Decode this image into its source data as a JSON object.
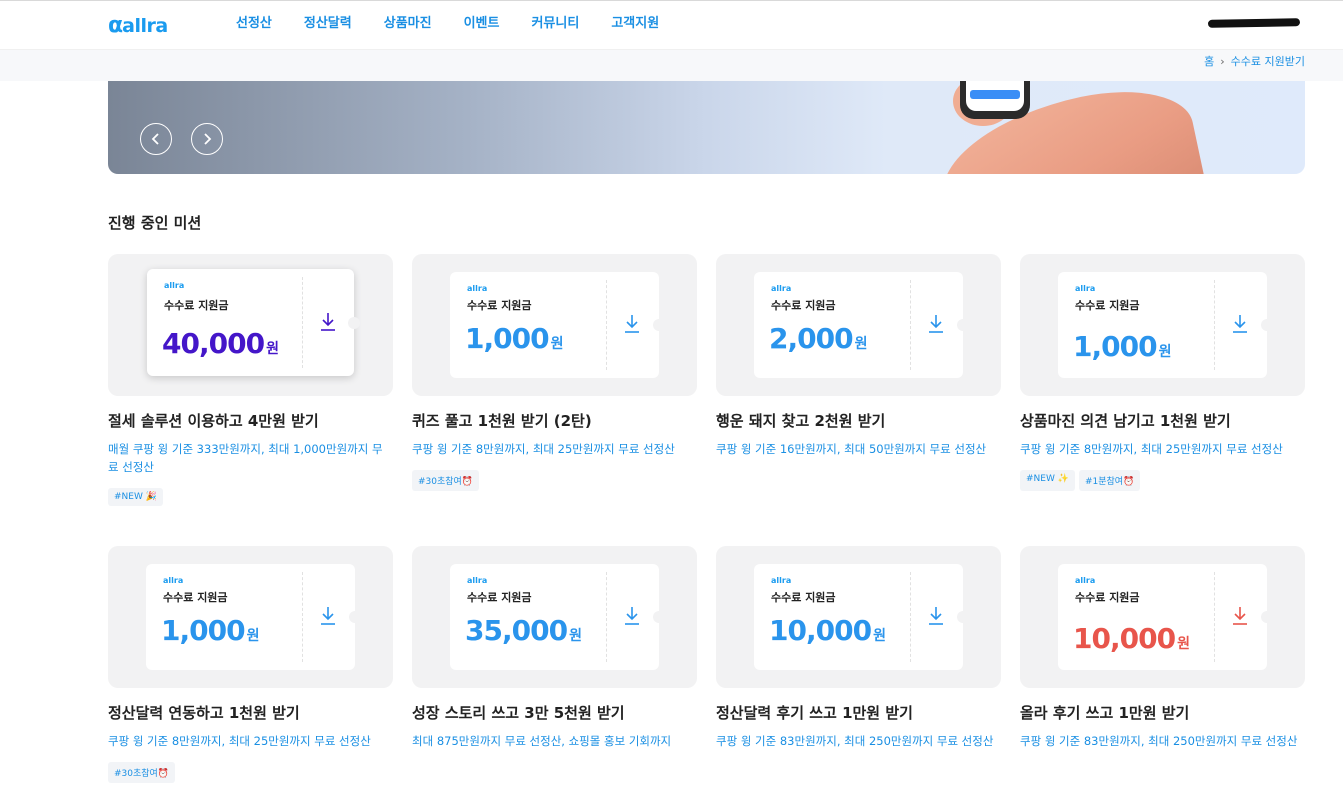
{
  "header": {
    "logo_mark": "α",
    "logo_word": "allra",
    "nav": [
      "선정산",
      "정산달력",
      "상품마진",
      "이벤트",
      "커뮤니티",
      "고객지원"
    ]
  },
  "breadcrumb": {
    "home": "홈",
    "current": "수수료 지원받기"
  },
  "banner": {
    "prev_icon": "chevron-left-icon",
    "next_icon": "chevron-right-icon"
  },
  "section": {
    "title": "진행 중인 미션"
  },
  "coupon": {
    "logo": "allra",
    "label": "수수료 지원금",
    "unit": "원"
  },
  "colors": {
    "brand": "#1a9bef",
    "purple": "#4416c9",
    "blue": "#2a94ec",
    "red": "#e8554b"
  },
  "missions": [
    {
      "amount": "40,000",
      "title": "절세 솔루션 이용하고 4만원 받기",
      "desc": "매월 쿠팡 윙 기준 333만원까지, 최대 1,000만원까지 무료 선정산",
      "tags": [
        "#NEW 🎉"
      ]
    },
    {
      "amount": "1,000",
      "title": "퀴즈 풀고 1천원 받기 (2탄)",
      "desc": "쿠팡 윙 기준 8만원까지, 최대 25만원까지 무료 선정산",
      "tags": [
        "#30초참여⏰"
      ]
    },
    {
      "amount": "2,000",
      "title": "행운 돼지 찾고 2천원 받기",
      "desc": "쿠팡 윙 기준 16만원까지, 최대 50만원까지 무료 선정산",
      "tags": []
    },
    {
      "amount": "1,000",
      "title": "상품마진 의견 남기고 1천원 받기",
      "desc": "쿠팡 윙 기준 8만원까지, 최대 25만원까지 무료 선정산",
      "tags": [
        "#NEW ✨",
        "#1분참여⏰"
      ]
    },
    {
      "amount": "1,000",
      "title": "정산달력 연동하고 1천원 받기",
      "desc": "쿠팡 윙 기준 8만원까지, 최대 25만원까지 무료 선정산",
      "tags": [
        "#30초참여⏰"
      ]
    },
    {
      "amount": "35,000",
      "title": "성장 스토리 쓰고 3만 5천원 받기",
      "desc": "최대 875만원까지 무료 선정산, 쇼핑몰 홍보 기회까지",
      "tags": []
    },
    {
      "amount": "10,000",
      "title": "정산달력 후기 쓰고 1만원 받기",
      "desc": "쿠팡 윙 기준 83만원까지, 최대 250만원까지 무료 선정산",
      "tags": []
    },
    {
      "amount": "10,000",
      "title": "올라 후기 쓰고 1만원 받기",
      "desc": "쿠팡 윙 기준 83만원까지, 최대 250만원까지 무료 선정산",
      "tags": []
    }
  ]
}
